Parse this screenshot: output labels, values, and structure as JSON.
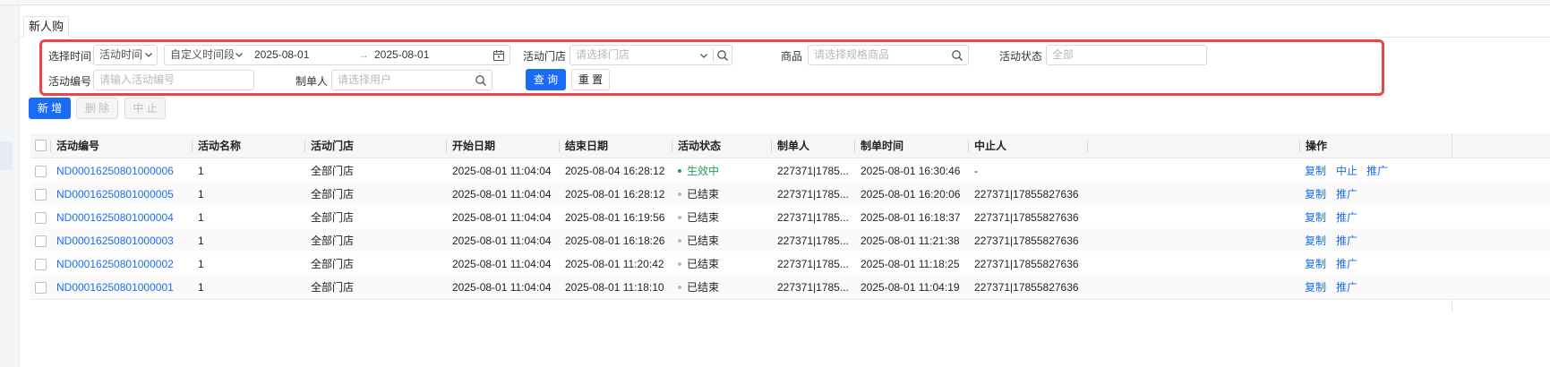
{
  "tab": {
    "label": "新人购"
  },
  "filters": {
    "select_time_label": "选择时间",
    "time_type": "活动时间",
    "period_type": "自定义时间段",
    "start_date": "2025-08-01",
    "arrow": "→",
    "end_date": "2025-08-01",
    "store_label": "活动门店",
    "store_placeholder": "请选择门店",
    "product_label": "商品",
    "product_placeholder": "请选择规格商品",
    "status_label": "活动状态",
    "status_value": "全部",
    "code_label": "活动编号",
    "code_placeholder": "请输入活动编号",
    "creator_label": "制单人",
    "creator_placeholder": "请选择用户",
    "query_button": "查 询",
    "reset_button": "重 置"
  },
  "toolbar": {
    "add": "新 增",
    "delete": "删 除",
    "stop": "中 止"
  },
  "table": {
    "headers": {
      "code": "活动编号",
      "name": "活动名称",
      "store": "活动门店",
      "start": "开始日期",
      "end": "结束日期",
      "status": "活动状态",
      "creator": "制单人",
      "created": "制单时间",
      "stopper": "中止人",
      "ops": "操作"
    },
    "rows": [
      {
        "code": "ND00016250801000006",
        "name": "1",
        "store": "全部门店",
        "start": "2025-08-01 11:04:04",
        "end": "2025-08-04 16:28:12",
        "status": "生效中",
        "creator": "227371|1785...",
        "created": "2025-08-01 16:30:46",
        "stopper": "-",
        "op1": "复制",
        "op2": "中止",
        "op3": "推广"
      },
      {
        "code": "ND00016250801000005",
        "name": "1",
        "store": "全部门店",
        "start": "2025-08-01 11:04:04",
        "end": "2025-08-01 16:28:12",
        "status": "已结束",
        "creator": "227371|1785...",
        "created": "2025-08-01 16:20:06",
        "stopper": "227371|17855827636",
        "op1": "复制",
        "op2": "推广"
      },
      {
        "code": "ND00016250801000004",
        "name": "1",
        "store": "全部门店",
        "start": "2025-08-01 11:04:04",
        "end": "2025-08-01 16:19:56",
        "status": "已结束",
        "creator": "227371|1785...",
        "created": "2025-08-01 16:18:37",
        "stopper": "227371|17855827636",
        "op1": "复制",
        "op2": "推广"
      },
      {
        "code": "ND00016250801000003",
        "name": "1",
        "store": "全部门店",
        "start": "2025-08-01 11:04:04",
        "end": "2025-08-01 16:18:26",
        "status": "已结束",
        "creator": "227371|1785...",
        "created": "2025-08-01 11:21:38",
        "stopper": "227371|17855827636",
        "op1": "复制",
        "op2": "推广"
      },
      {
        "code": "ND00016250801000002",
        "name": "1",
        "store": "全部门店",
        "start": "2025-08-01 11:04:04",
        "end": "2025-08-01 11:20:42",
        "status": "已结束",
        "creator": "227371|1785...",
        "created": "2025-08-01 11:18:25",
        "stopper": "227371|17855827636",
        "op1": "复制",
        "op2": "推广"
      },
      {
        "code": "ND00016250801000001",
        "name": "1",
        "store": "全部门店",
        "start": "2025-08-01 11:04:04",
        "end": "2025-08-01 11:18:10",
        "status": "已结束",
        "creator": "227371|1785...",
        "created": "2025-08-01 11:04:19",
        "stopper": "227371|17855827636",
        "op1": "复制",
        "op2": "推广"
      }
    ]
  },
  "colors": {
    "primary": "#1a6cf4",
    "active": "#22a058",
    "ended": "#b8b8b8",
    "highlight": "#e8454e"
  }
}
